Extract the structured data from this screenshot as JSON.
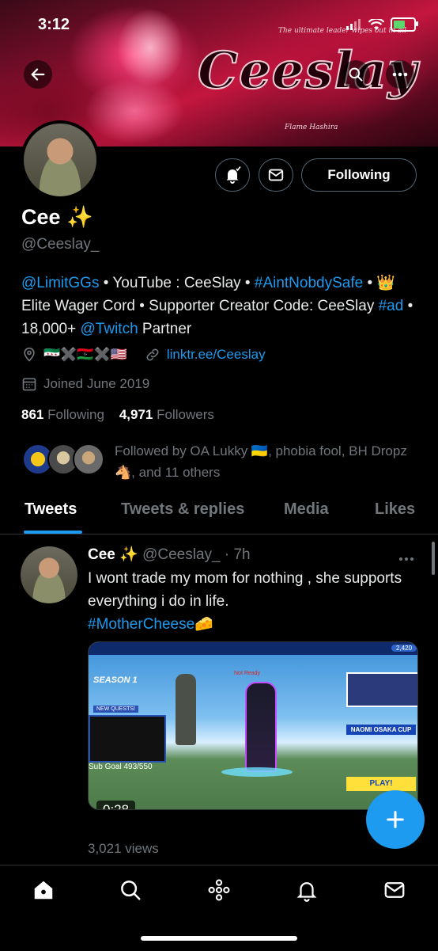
{
  "status_bar": {
    "time": "3:12"
  },
  "banner": {
    "title": "Ceeslay",
    "caption_top": "The ultimate leader wipes out in all",
    "caption_bottom": "Flame Hashira"
  },
  "profile": {
    "name": "Cee ✨",
    "handle": "@Ceeslay_",
    "following_button": "Following",
    "bio": {
      "tag1": "@LimitGGs",
      "part1": " • YouTube : CeeSlay • ",
      "tag2": "#AintNobdySafe",
      "part2": " • 👑 Elite Wager Cord • Supporter Creator Code: CeeSlay ",
      "tag3": "#ad",
      "part3": " • 18,000+ ",
      "tag4": "@Twitch",
      "part4": " Partner"
    },
    "flags": "🇸🇾✖️🇱🇾✖️🇺🇸",
    "website": "linktr.ee/Ceeslay",
    "joined": "Joined June 2019",
    "following_count": "861",
    "following_label": "Following",
    "followers_count": "4,971",
    "followers_label": "Followers",
    "followed_by": "Followed by OA Lukky 🇺🇦, phobia fool, BH Dropz 🐴, and 11 others"
  },
  "tabs": [
    {
      "label": "Tweets",
      "active": true
    },
    {
      "label": "Tweets & replies",
      "active": false
    },
    {
      "label": "Media",
      "active": false
    },
    {
      "label": "Likes",
      "active": false
    }
  ],
  "tweet": {
    "name": "Cee ✨",
    "handle": "@Ceeslay_",
    "time": "· 7h",
    "text": "I wont trade my mom for nothing , she supports everything i do in life.",
    "hashtag": "#MotherCheese🧀",
    "video_duration": "0:28",
    "video_overlay": {
      "season": "SEASON 1",
      "new_quests": "NEW QUESTS!",
      "sub_goal": "Sub Goal 493/550",
      "event": "NAOMI OSAKA CUP",
      "play": "PLAY!",
      "coins": "2,420",
      "ready": "Not Ready"
    },
    "views": "3,021 views"
  },
  "colors": {
    "accent": "#1d9bf0",
    "background": "#000000",
    "muted": "#71767b"
  },
  "icons": [
    "back-arrow-icon",
    "search-icon",
    "more-icon",
    "notification-bell-icon",
    "message-icon",
    "location-icon",
    "link-icon",
    "calendar-icon",
    "compose-icon",
    "home-icon",
    "explore-icon",
    "spaces-icon",
    "notifications-icon",
    "messages-icon"
  ]
}
